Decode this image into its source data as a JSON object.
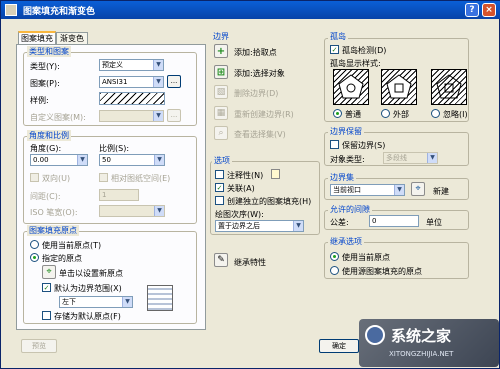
{
  "title": "图案填充和渐变色",
  "tabs": [
    "图案填充",
    "渐变色"
  ],
  "type_pattern": {
    "legend": "类型和图案",
    "type_label": "类型(Y):",
    "type_value": "预定义",
    "pattern_label": "图案(P):",
    "pattern_value": "ANSI31",
    "pattern_more": "...",
    "sample_label": "样例:",
    "custom_label": "自定义图案(M):",
    "custom_more": "..."
  },
  "angle_scale": {
    "legend": "角度和比例",
    "angle_label": "角度(G):",
    "angle_value": "0.00",
    "scale_label": "比例(S):",
    "scale_value": "50",
    "double_label": "双向(U)",
    "relative_label": "相对图纸空间(E)",
    "spacing_label": "间距(C):",
    "spacing_value": "1",
    "iso_label": "ISO 笔宽(O):"
  },
  "origin": {
    "legend": "图案填充原点",
    "use_current": "使用当前原点(T)",
    "specified": "指定的原点",
    "click_set": "单击以设置新原点",
    "default_boundary": "默认为边界范围(X)",
    "position": "左下",
    "store_default": "存储为默认原点(F)"
  },
  "boundaries": {
    "legend": "边界",
    "add_pick": "添加:拾取点",
    "add_select": "添加:选择对象",
    "remove": "删除边界(D)",
    "recreate": "重新创建边界(R)",
    "view": "查看选择集(V)"
  },
  "options": {
    "legend": "选项",
    "annotative": "注释性(N)",
    "associative": "关联(A)",
    "separate": "创建独立的图案填充(H)",
    "draw_order_label": "绘图次序(W):",
    "draw_order_value": "置于边界之后"
  },
  "inherit": "继承特性",
  "islands": {
    "legend": "孤岛",
    "detect": "孤岛检测(D)",
    "style_label": "孤岛显示样式:",
    "normal": "普通",
    "outer": "外部",
    "ignore": "忽略(I)"
  },
  "boundary_retention": {
    "legend": "边界保留",
    "retain": "保留边界(S)",
    "object_type_label": "对象类型:",
    "object_type_value": "多段线"
  },
  "boundary_set": {
    "legend": "边界集",
    "value": "当前视口",
    "new": "新建"
  },
  "gap": {
    "legend": "允许的间隙",
    "tolerance_label": "公差:",
    "tolerance_value": "0",
    "unit": "单位"
  },
  "inherit_options": {
    "legend": "继承选项",
    "current_origin": "使用当前原点",
    "source_origin": "使用源图案填充的原点"
  },
  "footer": {
    "preview": "预览",
    "ok": "确定",
    "watermark": "系统之家",
    "watermark_url": "XITONGZHIJIA.NET"
  },
  "colors": {
    "title_bar": "#0a5fd7",
    "group_label": "#0044cc",
    "dialog_bg": "#ece9d8"
  }
}
